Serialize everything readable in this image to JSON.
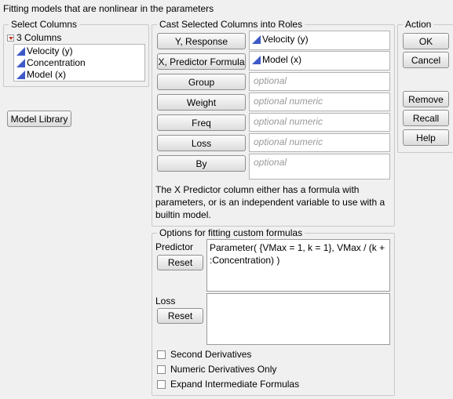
{
  "header": {
    "title": "Fitting models that are nonlinear in the parameters"
  },
  "select_columns": {
    "legend": "Select Columns",
    "count_label": "3 Columns",
    "columns": [
      "Velocity (y)",
      "Concentration",
      "Model (x)"
    ],
    "model_library_label": "Model Library"
  },
  "cast": {
    "legend": "Cast Selected Columns into Roles",
    "roles": [
      {
        "button": "Y, Response",
        "value": "Velocity (y)",
        "placeholder": ""
      },
      {
        "button": "X, Predictor Formula",
        "value": "Model (x)",
        "placeholder": ""
      },
      {
        "button": "Group",
        "value": "",
        "placeholder": "optional"
      },
      {
        "button": "Weight",
        "value": "",
        "placeholder": "optional numeric"
      },
      {
        "button": "Freq",
        "value": "",
        "placeholder": "optional numeric"
      },
      {
        "button": "Loss",
        "value": "",
        "placeholder": "optional numeric"
      },
      {
        "button": "By",
        "value": "",
        "placeholder": "optional"
      }
    ],
    "note": "The X Predictor column either has a formula with parameters, or is an independent variable to use with a builtin model."
  },
  "action": {
    "legend": "Action",
    "ok": "OK",
    "cancel": "Cancel",
    "remove": "Remove",
    "recall": "Recall",
    "help": "Help"
  },
  "options": {
    "legend": "Options for fitting custom formulas",
    "predictor_label": "Predictor",
    "predictor_formula": "Parameter( {VMax = 1, k = 1}, VMax / (k + :Concentration) )",
    "loss_label": "Loss",
    "reset_label": "Reset",
    "checkboxes": [
      "Second Derivatives",
      "Numeric Derivatives Only",
      "Expand Intermediate Formulas"
    ]
  },
  "colors": {
    "column_icon": "#3e59c7",
    "disclosure_icon": "#c0392b"
  }
}
